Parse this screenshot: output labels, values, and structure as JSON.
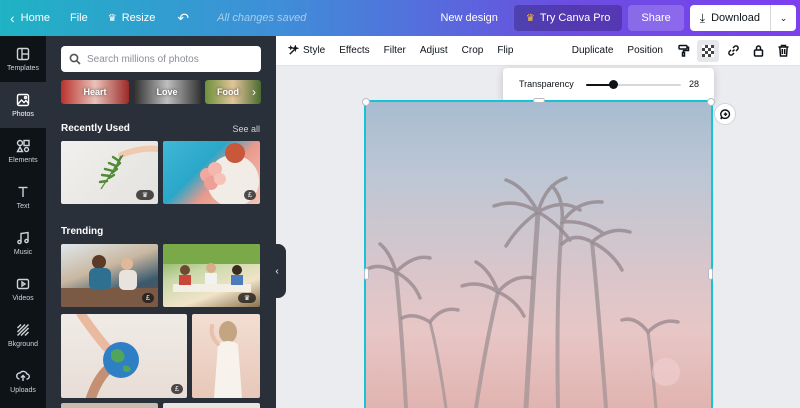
{
  "topbar": {
    "home": "Home",
    "file": "File",
    "resize": "Resize",
    "saved_status": "All changes saved",
    "new_design": "New design",
    "try_pro": "Try Canva Pro",
    "share": "Share",
    "download": "Download"
  },
  "rail": {
    "items": [
      {
        "label": "Templates",
        "icon": "templates-icon"
      },
      {
        "label": "Photos",
        "icon": "photos-icon"
      },
      {
        "label": "Elements",
        "icon": "elements-icon"
      },
      {
        "label": "Text",
        "icon": "text-icon"
      },
      {
        "label": "Music",
        "icon": "music-icon"
      },
      {
        "label": "Videos",
        "icon": "videos-icon"
      },
      {
        "label": "Bkground",
        "icon": "background-icon"
      },
      {
        "label": "Uploads",
        "icon": "uploads-icon"
      }
    ],
    "active": "Photos"
  },
  "panel": {
    "search_placeholder": "Search millions of photos",
    "categories": [
      "Heart",
      "Love",
      "Food"
    ],
    "recently_used_title": "Recently Used",
    "see_all": "See all",
    "trending_title": "Trending",
    "badges": {
      "crown": "♛",
      "pound": "£"
    }
  },
  "toolbar2": {
    "style": "Style",
    "effects": "Effects",
    "filter": "Filter",
    "adjust": "Adjust",
    "crop": "Crop",
    "flip": "Flip",
    "duplicate": "Duplicate",
    "position": "Position"
  },
  "transparency": {
    "label": "Transparency",
    "value": "28",
    "fraction": 0.28
  },
  "colors": {
    "accent": "#17c2d6",
    "rail_bg": "#0e1318",
    "panel_bg": "#293039",
    "canvas_bg": "#ebecf0"
  }
}
